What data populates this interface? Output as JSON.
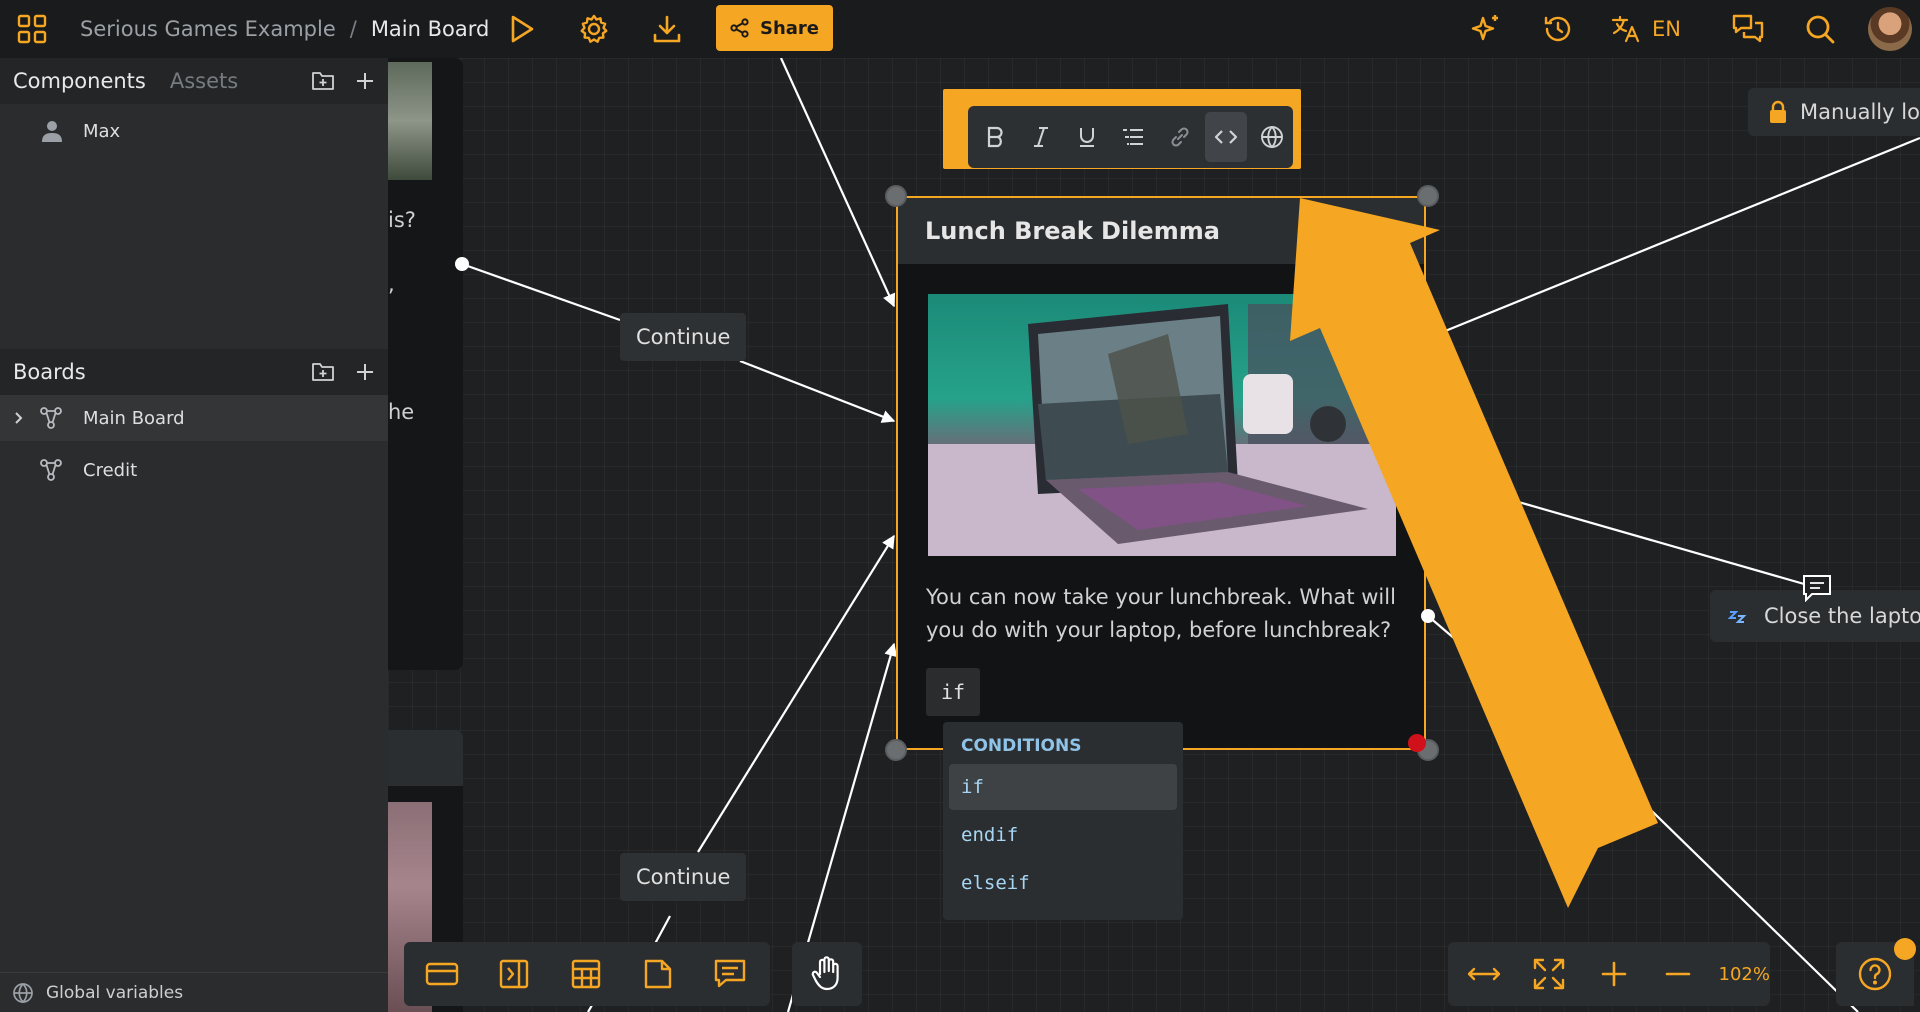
{
  "topbar": {
    "project": "Serious Games Example",
    "separator": "/",
    "board": "Main Board",
    "share_label": "Share",
    "language": "EN"
  },
  "sidebar": {
    "tabs": {
      "components": "Components",
      "assets": "Assets"
    },
    "components": [
      {
        "label": "Max",
        "icon": "person-icon"
      }
    ],
    "boards_title": "Boards",
    "boards": [
      {
        "label": "Main Board",
        "icon": "graph-icon",
        "selected": true
      },
      {
        "label": "Credit",
        "icon": "graph-icon"
      }
    ],
    "global_variables": "Global variables"
  },
  "canvas": {
    "fragments": [
      "is?",
      ",",
      "he"
    ],
    "continue_top": "Continue",
    "continue_bottom": "Continue",
    "node": {
      "title": "Lunch Break Dilemma",
      "text": "You can now take your lunchbreak. What will you do with your laptop, before lunchbreak?",
      "chip": "if"
    },
    "conditions": {
      "header": "CONDITIONS",
      "items": [
        "if",
        "endif",
        "elseif"
      ],
      "selected": "if"
    },
    "lock_badge": "Manually lo",
    "close_badge": "Close the lapto",
    "zoom": "102%"
  },
  "colors": {
    "accent": "#f5a623",
    "background": "#1f2022",
    "sidebar": "#2a2c2e",
    "condition_text": "#a7d6f4"
  }
}
